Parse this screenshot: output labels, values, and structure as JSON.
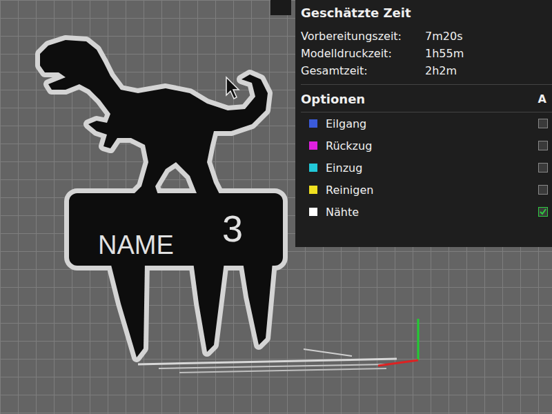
{
  "estimate": {
    "title": "Geschätzte Zeit",
    "rows": [
      {
        "label": "Vorbereitungszeit:",
        "value": "7m20s"
      },
      {
        "label": "Modelldruckzeit:",
        "value": "1h55m"
      },
      {
        "label": "Gesamtzeit:",
        "value": "2h2m"
      }
    ]
  },
  "options": {
    "title": "Optionen",
    "column_header": "A",
    "items": [
      {
        "label": "Eilgang",
        "color": "#3b5bdb",
        "checked": false
      },
      {
        "label": "Rückzug",
        "color": "#e020e0",
        "checked": false
      },
      {
        "label": "Einzug",
        "color": "#22c8d8",
        "checked": false
      },
      {
        "label": "Reinigen",
        "color": "#f0e020",
        "checked": false
      },
      {
        "label": "Nähte",
        "color": "#ffffff",
        "checked": true
      }
    ]
  },
  "model": {
    "name_text": "NAME",
    "number_text": "3"
  }
}
